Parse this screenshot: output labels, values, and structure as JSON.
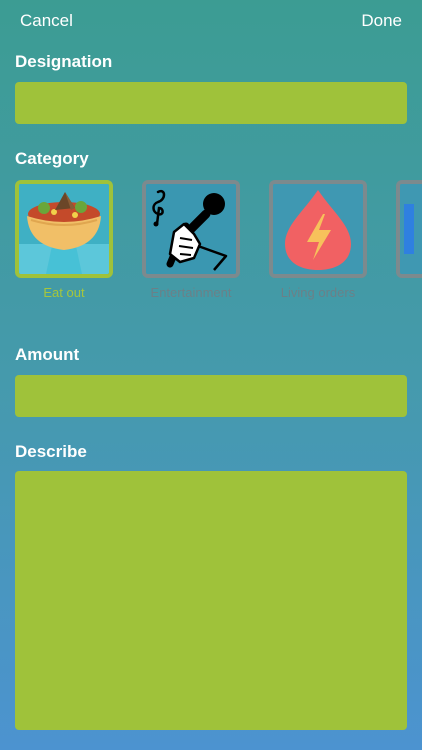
{
  "nav": {
    "cancel_label": "Cancel",
    "done_label": "Done"
  },
  "designation": {
    "label": "Designation",
    "value": ""
  },
  "category": {
    "label": "Category",
    "items": [
      {
        "label": "Eat out",
        "icon": "food-bowl-icon",
        "selected": true
      },
      {
        "label": "Entertainment",
        "icon": "microphone-icon",
        "selected": false
      },
      {
        "label": "Living orders",
        "icon": "energy-drop-icon",
        "selected": false
      }
    ]
  },
  "amount": {
    "label": "Amount",
    "value": ""
  },
  "describe": {
    "label": "Describe",
    "value": ""
  },
  "colors": {
    "field_fill": "#9fc23a",
    "selected_border": "#9fc23a",
    "unselected_border": "#7c8a8e",
    "energy_drop": "#f16163"
  }
}
